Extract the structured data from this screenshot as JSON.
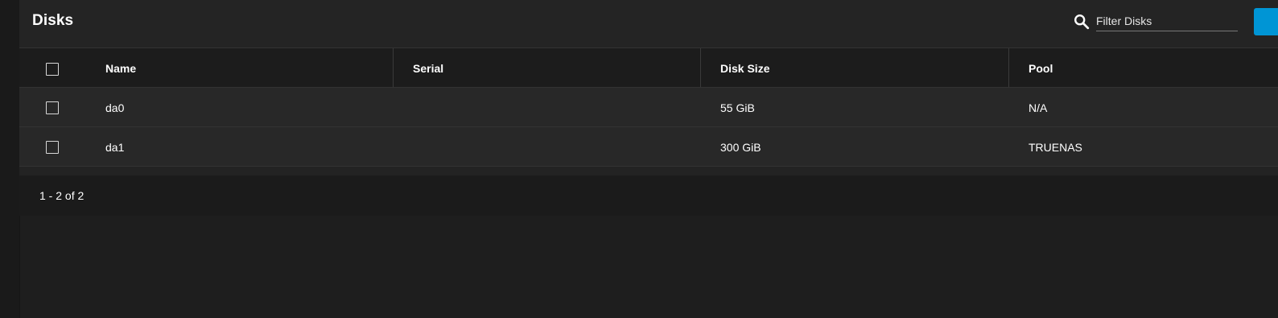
{
  "card": {
    "title": "Disks"
  },
  "search": {
    "icon": "search-icon",
    "placeholder": "Filter Disks",
    "value": ""
  },
  "colors": {
    "accent": "#0095d5",
    "background": "#1e1e1e",
    "card": "#232323",
    "row": "#282828",
    "header_row": "#1c1c1c"
  },
  "table": {
    "columns": [
      "Name",
      "Serial",
      "Disk Size",
      "Pool"
    ],
    "rows": [
      {
        "name": "da0",
        "serial": "",
        "size": "55 GiB",
        "pool": "N/A"
      },
      {
        "name": "da1",
        "serial": "",
        "size": "300 GiB",
        "pool": "TRUENAS"
      }
    ]
  },
  "paginator": {
    "range": "1 - 2 of 2"
  }
}
